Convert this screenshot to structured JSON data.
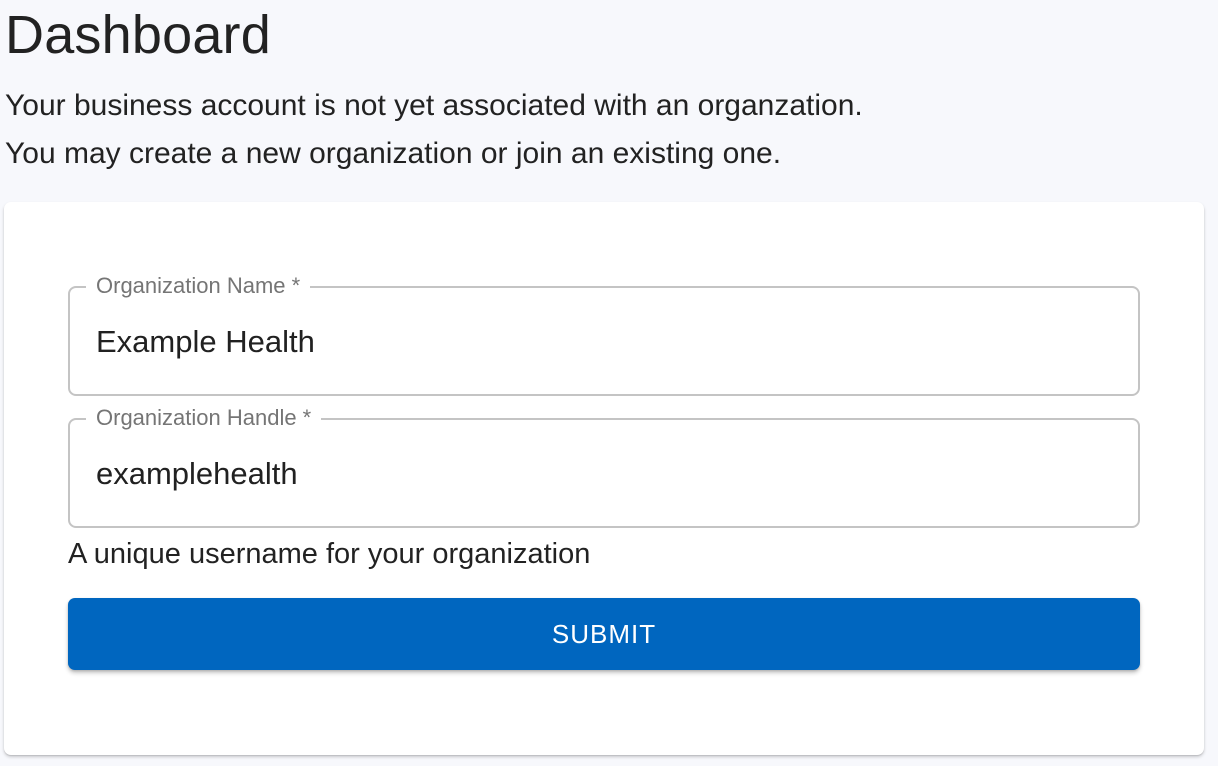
{
  "header": {
    "title": "Dashboard",
    "intro_line_1": "Your business account is not yet associated with an organzation.",
    "intro_line_2": "You may create a new organization or join an existing one."
  },
  "form": {
    "organization_name": {
      "label": "Organization Name *",
      "value": "Example Health"
    },
    "organization_handle": {
      "label": "Organization Handle *",
      "value": "examplehealth",
      "helper": "A unique username for your organization"
    },
    "submit_label": "SUBMIT"
  },
  "colors": {
    "page_background": "#f7f8fc",
    "card_background": "#ffffff",
    "primary": "#0066bf",
    "field_border": "#c4c4c4",
    "label_text": "#757575",
    "body_text": "#222222"
  }
}
